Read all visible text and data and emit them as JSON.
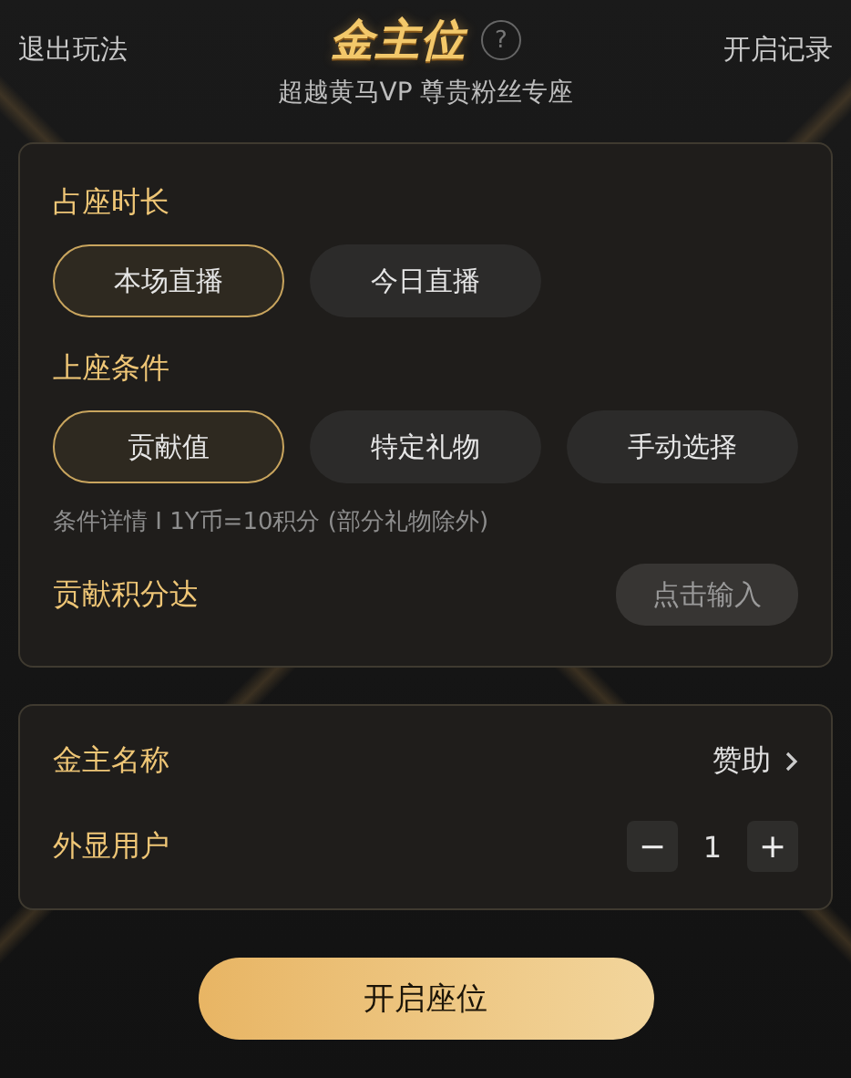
{
  "header": {
    "exit_label": "退出玩法",
    "logo": "金主位",
    "help_icon": "?",
    "subtitle": "超越黄马VP 尊贵粉丝专座",
    "records_label": "开启记录"
  },
  "duration": {
    "title": "占座时长",
    "options": [
      {
        "label": "本场直播",
        "selected": true
      },
      {
        "label": "今日直播",
        "selected": false
      }
    ]
  },
  "condition": {
    "title": "上座条件",
    "options": [
      {
        "label": "贡献值",
        "selected": true
      },
      {
        "label": "特定礼物",
        "selected": false
      },
      {
        "label": "手动选择",
        "selected": false
      }
    ],
    "detail": "条件详情 I 1Y币=10积分 (部分礼物除外)",
    "threshold_label": "贡献积分达",
    "threshold_placeholder": "点击输入"
  },
  "settings": {
    "name_label": "金主名称",
    "name_value": "赞助",
    "display_label": "外显用户",
    "minus": "−",
    "count": "1",
    "plus": "+"
  },
  "submit": "开启座位"
}
